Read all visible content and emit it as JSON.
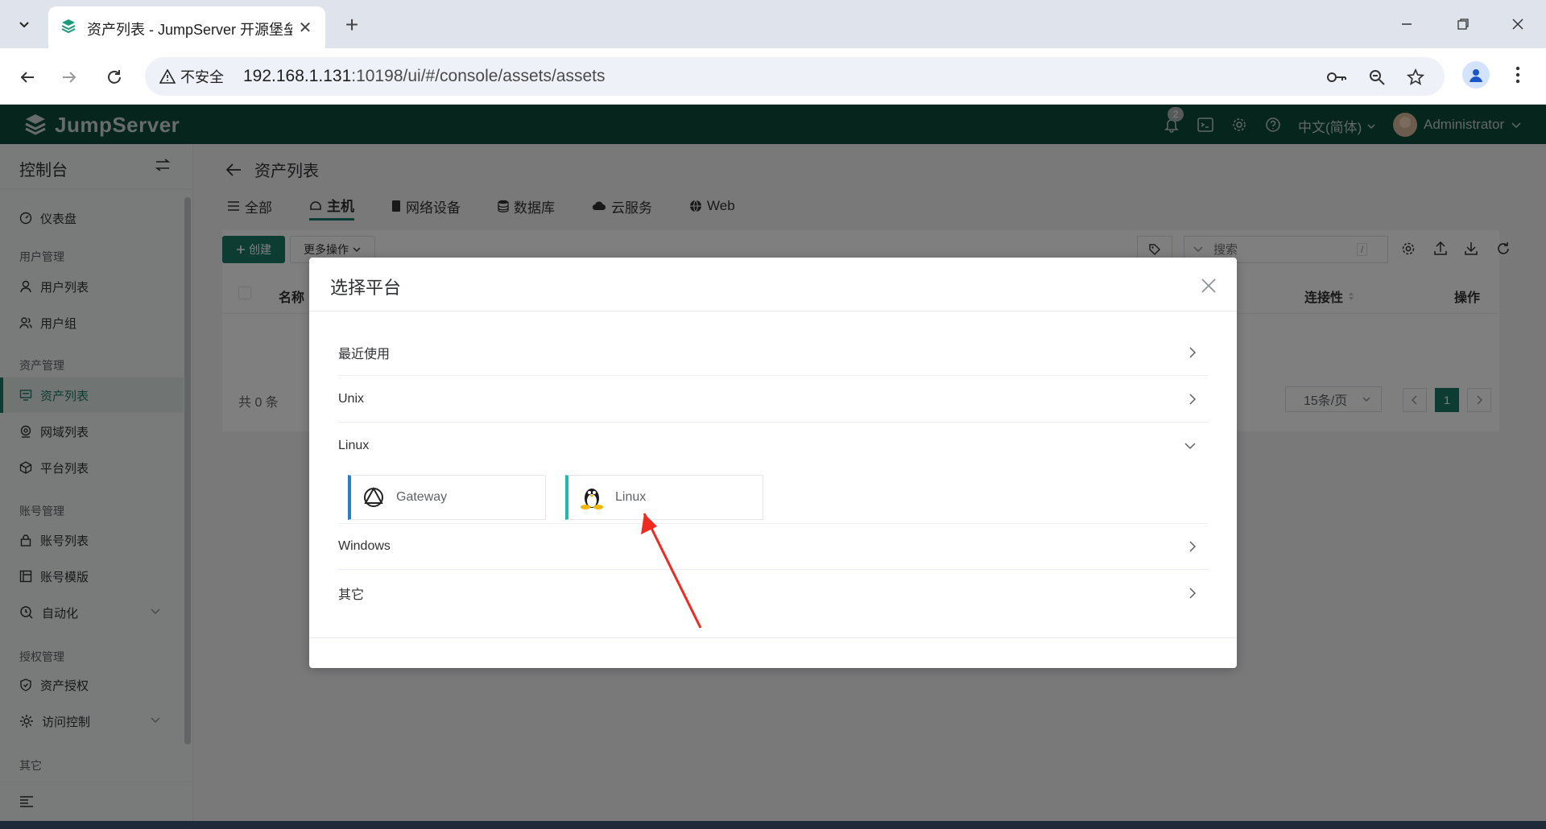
{
  "browser": {
    "tab_title": "资产列表 - JumpServer 开源堡垒机",
    "new_tab": "+",
    "close_tab": "✕",
    "security_label": "不安全",
    "url_host": "192.168.1.131",
    "url_path": ":10198/ui/#/console/assets/assets"
  },
  "header": {
    "logo_text": "JumpServer",
    "notification_count": "2",
    "language": "中文(简体)",
    "username": "Administrator"
  },
  "sidebar": {
    "title": "控制台",
    "dashboard": "仪表盘",
    "group_users": "用户管理",
    "user_list": "用户列表",
    "user_group": "用户组",
    "group_assets": "资产管理",
    "asset_list": "资产列表",
    "domain_list": "网域列表",
    "platform_list": "平台列表",
    "group_accounts": "账号管理",
    "account_list": "账号列表",
    "account_template": "账号模版",
    "automation": "自动化",
    "group_perms": "授权管理",
    "asset_perm": "资产授权",
    "access_control": "访问控制",
    "group_other": "其它"
  },
  "main": {
    "title": "资产列表",
    "tabs": [
      "全部",
      "主机",
      "网络设备",
      "数据库",
      "云服务",
      "Web"
    ],
    "create_btn": "创建",
    "more_btn": "更多操作",
    "search_placeholder": "搜索",
    "search_shortcut": "/",
    "col_name": "名称",
    "col_connectivity": "连接性",
    "col_actions": "操作",
    "total": "共 0 条",
    "page_size": "15条/页",
    "current_page": "1"
  },
  "dialog": {
    "title": "选择平台",
    "sections": {
      "recent": "最近使用",
      "unix": "Unix",
      "linux": "Linux",
      "windows": "Windows",
      "other": "其它"
    },
    "platforms": {
      "gateway": "Gateway",
      "linux": "Linux"
    }
  },
  "colors": {
    "brand": "#0b4a3a",
    "accent": "#1a7a64",
    "annotation_arrow": "#f02a1e"
  }
}
